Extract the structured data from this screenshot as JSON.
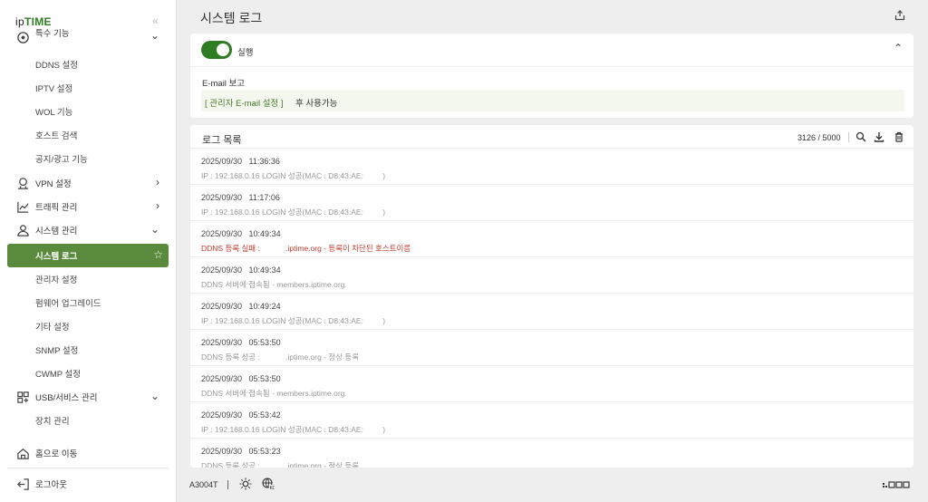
{
  "brand": {
    "prefix": "ip",
    "name": "TIME"
  },
  "sidebar": {
    "partial_top": {
      "label": "특수 기능"
    },
    "items": [
      {
        "label": "DDNS 설정"
      },
      {
        "label": "IPTV 설정"
      },
      {
        "label": "WOL 기능"
      },
      {
        "label": "호스트 검색"
      },
      {
        "label": "공지/광고 기능"
      },
      {
        "label": "VPN 설정",
        "icon": "vpn-icon"
      },
      {
        "label": "트래픽 관리",
        "icon": "traffic-icon"
      },
      {
        "label": "시스템 관리",
        "icon": "system-icon"
      },
      {
        "label": "시스템 로그"
      },
      {
        "label": "관리자 설정"
      },
      {
        "label": "펌웨어 업그레이드"
      },
      {
        "label": "기타 설정"
      },
      {
        "label": "SNMP 설정"
      },
      {
        "label": "CWMP 설정"
      },
      {
        "label": "USB/서비스 관리",
        "icon": "usb-icon"
      },
      {
        "label": "장치 관리"
      }
    ],
    "home": "홈으로 이동",
    "logout": "로그아웃"
  },
  "header": {
    "title": "시스템 로그"
  },
  "settings": {
    "run_label": "실행",
    "run_enabled": true,
    "email_label": "E-mail 보고",
    "email_link": "[ 관리자 E-mail 설정 ]",
    "email_suffix": "후 사용가능"
  },
  "log": {
    "title": "로그 목록",
    "count": "3126 / 5000",
    "entries": [
      {
        "ts": "2025/09/30   11:36:36",
        "msg": "IP : 192.168.0.16 LOGIN 성공(MAC : D8:43:AE:         )",
        "error": false
      },
      {
        "ts": "2025/09/30   11:17:06",
        "msg": "IP : 192.168.0.16 LOGIN 성공(MAC : D8:43:AE:         )",
        "error": false
      },
      {
        "ts": "2025/09/30   10:49:34",
        "msg": "DDNS 등록 실패 :            .iptime.org - 등록이 차단된 호스트이름",
        "error": true
      },
      {
        "ts": "2025/09/30   10:49:34",
        "msg": "DDNS 서버에 접속됨 - members.iptime.org.",
        "error": false
      },
      {
        "ts": "2025/09/30   10:49:24",
        "msg": "IP : 192.168.0.16 LOGIN 성공(MAC : D8:43:AE:         )",
        "error": false
      },
      {
        "ts": "2025/09/30   05:53:50",
        "msg": "DDNS 등록 성공 :            .iptime.org - 정상 등록",
        "error": false
      },
      {
        "ts": "2025/09/30   05:53:50",
        "msg": "DDNS 서버에 접속됨 - members.iptime.org.",
        "error": false
      },
      {
        "ts": "2025/09/30   05:53:42",
        "msg": "IP : 192.168.0.16 LOGIN 성공(MAC : D8:43:AE:         )",
        "error": false
      },
      {
        "ts": "2025/09/30   05:53:23",
        "msg": "DDNS 등록 성공 :            .iptime.org - 정상 등록",
        "error": false
      }
    ]
  },
  "footer": {
    "model": "A3004T"
  },
  "colors": {
    "accent": "#2f7d22",
    "active_bg": "#5a8a3c",
    "error": "#c0392b"
  }
}
